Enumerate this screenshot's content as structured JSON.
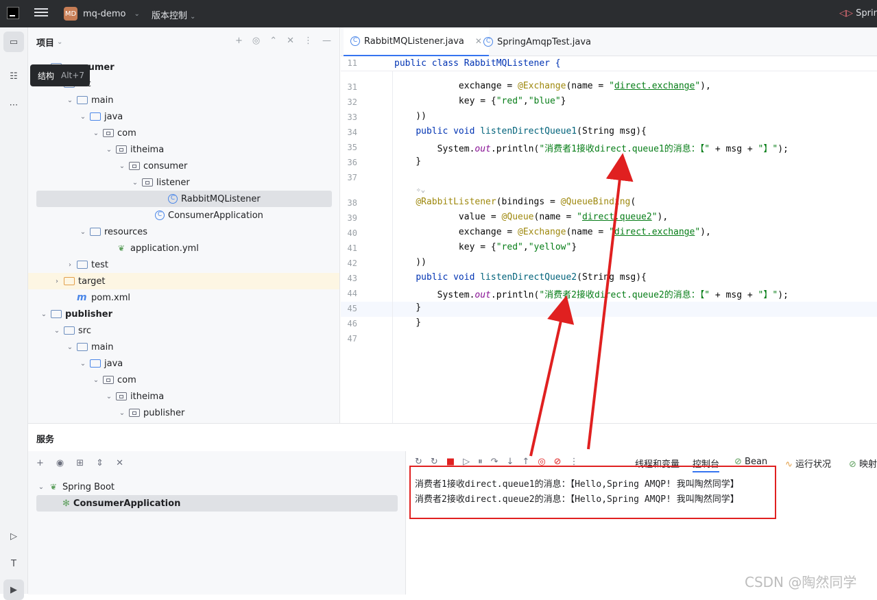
{
  "titlebar": {
    "badge": "MD",
    "project": "mq-demo",
    "vcs": "版本控制",
    "right": "Spring"
  },
  "tooltip": {
    "label": "结构",
    "shortcut": "Alt+7"
  },
  "project_panel": {
    "title": "项目",
    "tree": [
      {
        "label": "consumer",
        "depth": 0,
        "arrow": "",
        "icon": "folder",
        "bold": true
      },
      {
        "label": "src",
        "depth": 1,
        "arrow": "⌄",
        "icon": "folder"
      },
      {
        "label": "main",
        "depth": 2,
        "arrow": "⌄",
        "icon": "folder"
      },
      {
        "label": "java",
        "depth": 3,
        "arrow": "⌄",
        "icon": "folder-blue"
      },
      {
        "label": "com",
        "depth": 4,
        "arrow": "⌄",
        "icon": "pkg"
      },
      {
        "label": "itheima",
        "depth": 5,
        "arrow": "⌄",
        "icon": "pkg"
      },
      {
        "label": "consumer",
        "depth": 6,
        "arrow": "⌄",
        "icon": "pkg"
      },
      {
        "label": "listener",
        "depth": 7,
        "arrow": "⌄",
        "icon": "pkg"
      },
      {
        "label": "RabbitMQListener",
        "depth": 9,
        "arrow": "",
        "icon": "cls",
        "selected": true
      },
      {
        "label": "ConsumerApplication",
        "depth": 8,
        "arrow": "",
        "icon": "cls"
      },
      {
        "label": "resources",
        "depth": 3,
        "arrow": "⌄",
        "icon": "folder"
      },
      {
        "label": "application.yml",
        "depth": 5,
        "arrow": "",
        "icon": "leaf"
      },
      {
        "label": "test",
        "depth": 2,
        "arrow": "›",
        "icon": "folder"
      },
      {
        "label": "target",
        "depth": 1,
        "arrow": "›",
        "icon": "folder-orange",
        "highlight": true
      },
      {
        "label": "pom.xml",
        "depth": 2,
        "arrow": "",
        "icon": "mvn"
      },
      {
        "label": "publisher",
        "depth": 0,
        "arrow": "⌄",
        "icon": "folder",
        "bold": true
      },
      {
        "label": "src",
        "depth": 1,
        "arrow": "⌄",
        "icon": "folder"
      },
      {
        "label": "main",
        "depth": 2,
        "arrow": "⌄",
        "icon": "folder"
      },
      {
        "label": "java",
        "depth": 3,
        "arrow": "⌄",
        "icon": "folder-blue"
      },
      {
        "label": "com",
        "depth": 4,
        "arrow": "⌄",
        "icon": "pkg"
      },
      {
        "label": "itheima",
        "depth": 5,
        "arrow": "⌄",
        "icon": "pkg"
      },
      {
        "label": "publisher",
        "depth": 6,
        "arrow": "⌄",
        "icon": "pkg"
      }
    ]
  },
  "tabs": [
    {
      "label": "RabbitMQListener.java",
      "active": true
    },
    {
      "label": "SpringAmqpTest.java",
      "active": false
    }
  ],
  "editor": {
    "sticky": {
      "num": "11",
      "code": "public class RabbitMQListener {"
    },
    "lines": [
      {
        "num": "31",
        "html": "        exchange = <span class='ann'>@Exchange</span>(name = <span class='str'>\"<span class='ul'>direct.exchange</span>\"</span>),"
      },
      {
        "num": "32",
        "html": "        key = {<span class='str'>\"red\"</span>,<span class='str'>\"blue\"</span>}"
      },
      {
        "num": "33",
        "html": "))"
      },
      {
        "num": "34",
        "html": "<span class='kw'>public void</span> <span class='fn'>listenDirectQueue1</span>(String msg){"
      },
      {
        "num": "35",
        "html": "    System.<span class='st'>out</span>.println(<span class='str'>\"消费者1接收direct.queue1的消息：【\"</span> + msg + <span class='str'>\"】\"</span>);"
      },
      {
        "num": "36",
        "html": "}"
      },
      {
        "num": "37",
        "html": ""
      },
      {
        "num": "38",
        "html": "<span class='ann'>@RabbitListener</span>(bindings = <span class='ann'>@QueueBinding</span>("
      },
      {
        "num": "39",
        "html": "        value = <span class='ann'>@Queue</span>(name = <span class='str'>\"<span class='ul'>direct.queue2</span>\"</span>),"
      },
      {
        "num": "40",
        "html": "        exchange = <span class='ann'>@Exchange</span>(name = <span class='str'>\"<span class='ul'>direct.exchange</span>\"</span>),"
      },
      {
        "num": "41",
        "html": "        key = {<span class='str'>\"red\"</span>,<span class='str'>\"yellow\"</span>}"
      },
      {
        "num": "42",
        "html": "))"
      },
      {
        "num": "43",
        "html": "<span class='kw'>public void</span> <span class='fn'>listenDirectQueue2</span>(String msg){"
      },
      {
        "num": "44",
        "html": "    System.<span class='st'>out</span>.println(<span class='str'>\"消费者2接收direct.queue2的消息：【\"</span> + msg + <span class='str'>\"】\"</span>);"
      },
      {
        "num": "45",
        "html": "}"
      },
      {
        "num": "46",
        "html": "}"
      },
      {
        "num": "47",
        "html": ""
      }
    ]
  },
  "services": {
    "title": "服务",
    "root": "Spring Boot",
    "app": "ConsumerApplication",
    "console_tabs": [
      "线程和变量",
      "控制台",
      "Bean",
      "运行状况",
      "映射"
    ],
    "output": [
      "消费者1接收direct.queue1的消息：【Hello,Spring AMQP! 我叫陶然同学】",
      "消费者2接收direct.queue2的消息：【Hello,Spring AMQP! 我叫陶然同学】"
    ]
  },
  "watermark": "CSDN @陶然同学",
  "colors": {
    "annotation_box": "#e02020",
    "accent": "#3574f0"
  }
}
